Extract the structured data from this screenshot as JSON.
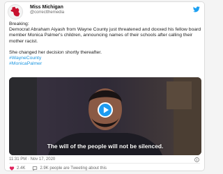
{
  "tweet": {
    "author_name": "Miss Michigan",
    "author_handle": "@correctthemedia",
    "lines": {
      "intro": "Breaking:",
      "body": "Democrat Abraham Aiyash from Wayne County just threatened and doxxed his fellow board member Monica Palmer's children, announcing names of their schools after calling their mother racist.",
      "followup": "She changed her decision shortly thereafter.",
      "hashtag1": "#WayneCounty",
      "hashtag2": "#MonicaPalmer"
    },
    "media": {
      "caption": "The will of the people will not be silenced.",
      "icon": "play-icon"
    },
    "timestamp": "11:31 PM · Nov 17, 2020",
    "likes": "2.4K",
    "people_talking": "2.9K people are Tweeting about this"
  },
  "icons": {
    "brand": "twitter-bird-icon",
    "info": "info-icon",
    "like": "heart-icon",
    "talk": "speech-bubble-icon"
  },
  "colors": {
    "accent": "#1b95e0",
    "play_button": "#1d9bf0",
    "text": "#1c1c1c",
    "muted": "#6b6b6b",
    "heart": "#e0245e"
  }
}
